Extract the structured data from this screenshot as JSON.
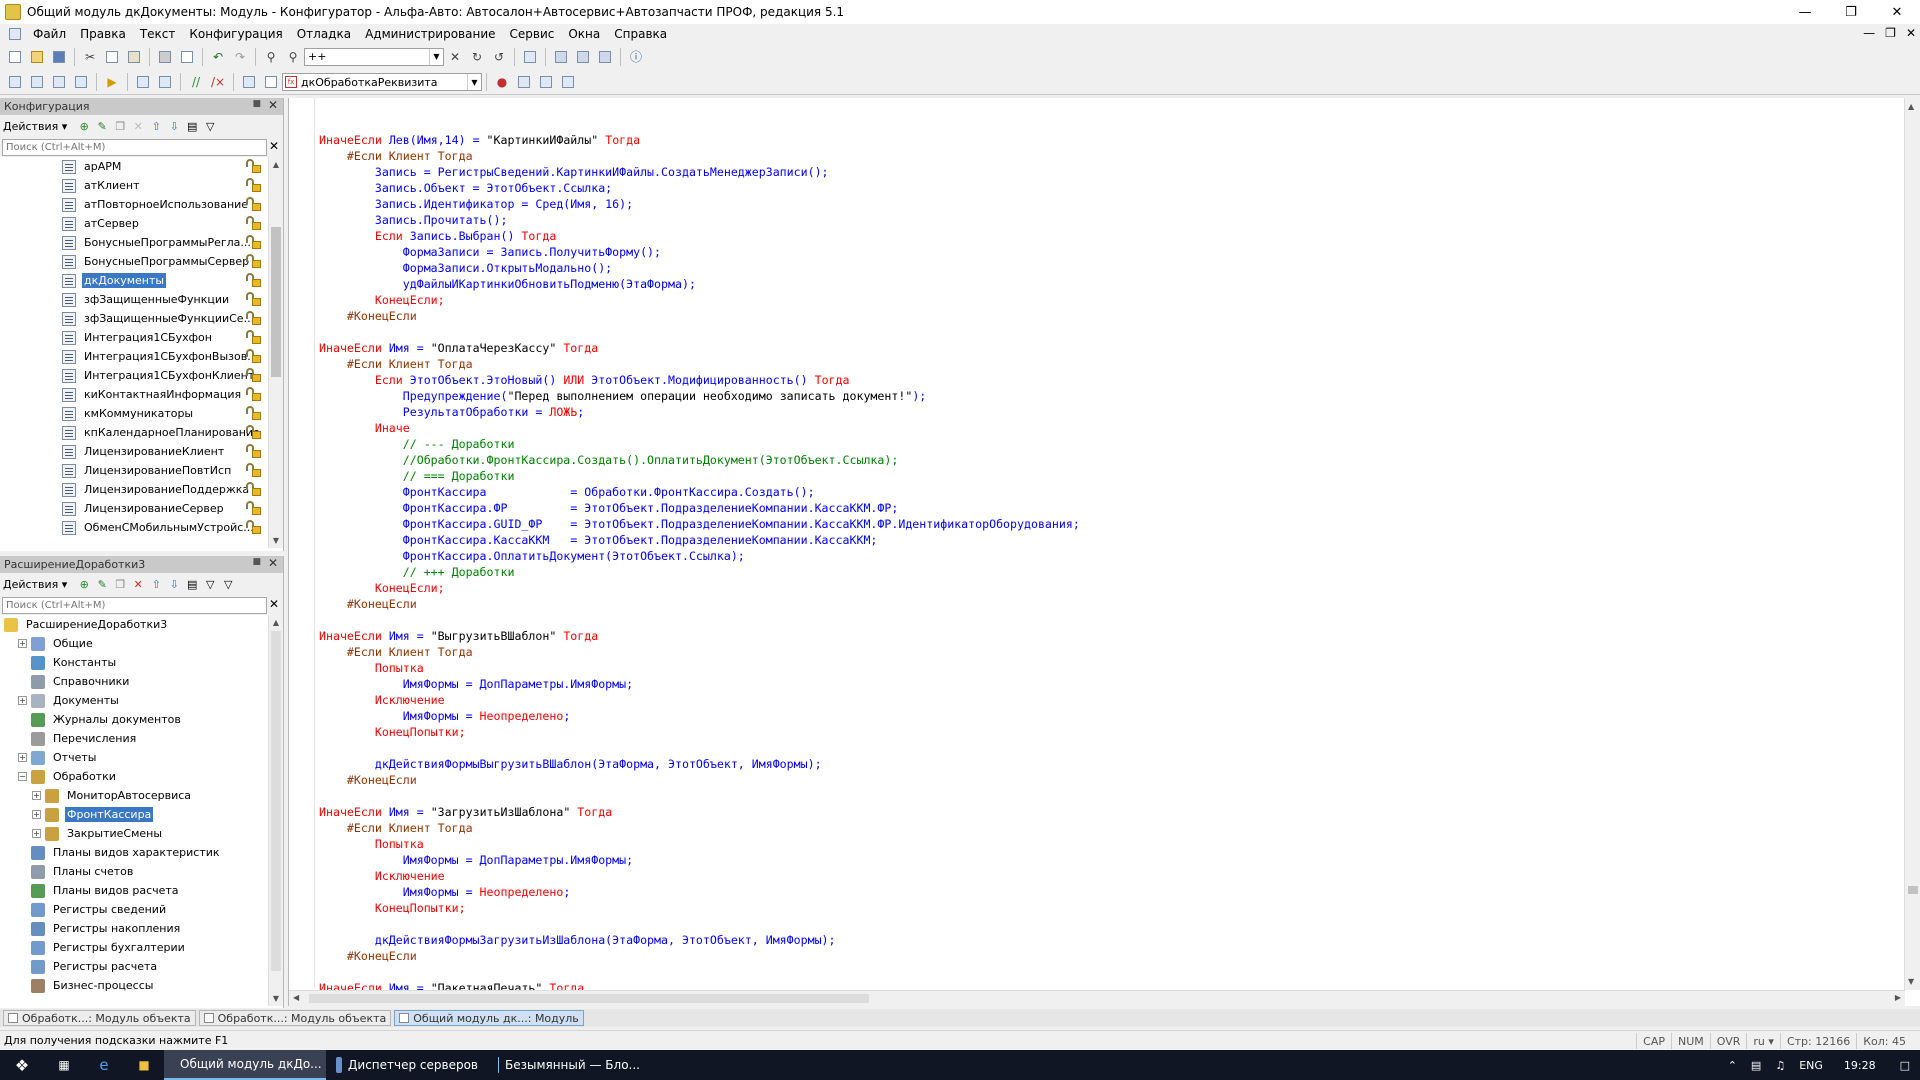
{
  "window": {
    "title": "Общий модуль дкДокументы: Модуль - Конфигуратор - Альфа-Авто: Автосалон+Автосервис+Автозапчасти ПРОФ, редакция 5.1"
  },
  "menu": [
    "Файл",
    "Правка",
    "Текст",
    "Конфигурация",
    "Отладка",
    "Администрирование",
    "Сервис",
    "Окна",
    "Справка"
  ],
  "toolbar": {
    "search_value": "++",
    "procedure_combo": "дкОбработкаРеквизита"
  },
  "config_panel": {
    "title": "Конфигурация",
    "actions_label": "Действия",
    "search_placeholder": "Поиск (Ctrl+Alt+M)",
    "items": [
      {
        "label": "арАРМ",
        "selected": false
      },
      {
        "label": "атКлиент",
        "selected": false
      },
      {
        "label": "атПовторноеИспользование",
        "selected": false
      },
      {
        "label": "атСервер",
        "selected": false
      },
      {
        "label": "БонусныеПрограммыРегла...",
        "selected": false
      },
      {
        "label": "БонусныеПрограммыСервер",
        "selected": false
      },
      {
        "label": "дкДокументы",
        "selected": true
      },
      {
        "label": "зфЗащищенныеФункции",
        "selected": false
      },
      {
        "label": "зфЗащищенныеФункцииСе...",
        "selected": false
      },
      {
        "label": "Интеграция1СБухфон",
        "selected": false
      },
      {
        "label": "Интеграция1СБухфонВызов...",
        "selected": false
      },
      {
        "label": "Интеграция1СБухфонКлиент",
        "selected": false
      },
      {
        "label": "киКонтактнаяИнформация",
        "selected": false
      },
      {
        "label": "кмКоммуникаторы",
        "selected": false
      },
      {
        "label": "кпКалендарноеПланирование",
        "selected": false
      },
      {
        "label": "ЛицензированиеКлиент",
        "selected": false
      },
      {
        "label": "ЛицензированиеПовтИсп",
        "selected": false
      },
      {
        "label": "ЛицензированиеПоддержка",
        "selected": false
      },
      {
        "label": "ЛицензированиеСервер",
        "selected": false
      },
      {
        "label": "ОбменСМобильнымУстройс...",
        "selected": false
      }
    ]
  },
  "ext_panel": {
    "title": "РасширениеДоработки3",
    "actions_label": "Действия",
    "search_placeholder": "Поиск (Ctrl+Alt+M)",
    "items": [
      {
        "label": "РасширениеДоработки3",
        "level": 0,
        "exp": "",
        "icon": "extension-icon",
        "selected": false
      },
      {
        "label": "Общие",
        "level": 1,
        "exp": "+",
        "icon": "common-icon",
        "selected": false
      },
      {
        "label": "Константы",
        "level": 1,
        "exp": "",
        "icon": "constants-icon",
        "selected": false
      },
      {
        "label": "Справочники",
        "level": 1,
        "exp": "",
        "icon": "catalogs-icon",
        "selected": false
      },
      {
        "label": "Документы",
        "level": 1,
        "exp": "+",
        "icon": "documents-icon",
        "selected": false
      },
      {
        "label": "Журналы документов",
        "level": 1,
        "exp": "",
        "icon": "journals-icon",
        "selected": false
      },
      {
        "label": "Перечисления",
        "level": 1,
        "exp": "",
        "icon": "enums-icon",
        "selected": false
      },
      {
        "label": "Отчеты",
        "level": 1,
        "exp": "+",
        "icon": "reports-icon",
        "selected": false
      },
      {
        "label": "Обработки",
        "level": 1,
        "exp": "−",
        "icon": "processing-icon",
        "selected": false
      },
      {
        "label": "МониторАвтосервиса",
        "level": 2,
        "exp": "+",
        "icon": "processing-item-icon",
        "selected": false
      },
      {
        "label": "ФронтКассира",
        "level": 2,
        "exp": "+",
        "icon": "processing-item-icon",
        "selected": true
      },
      {
        "label": "ЗакрытиеСмены",
        "level": 2,
        "exp": "+",
        "icon": "processing-item-icon",
        "selected": false
      },
      {
        "label": "Планы видов характеристик",
        "level": 1,
        "exp": "",
        "icon": "chart-of-characteristics-icon",
        "selected": false
      },
      {
        "label": "Планы счетов",
        "level": 1,
        "exp": "",
        "icon": "chart-of-accounts-icon",
        "selected": false
      },
      {
        "label": "Планы видов расчета",
        "level": 1,
        "exp": "",
        "icon": "chart-of-calculation-icon",
        "selected": false
      },
      {
        "label": "Регистры сведений",
        "level": 1,
        "exp": "",
        "icon": "info-registers-icon",
        "selected": false
      },
      {
        "label": "Регистры накопления",
        "level": 1,
        "exp": "",
        "icon": "accumulation-registers-icon",
        "selected": false
      },
      {
        "label": "Регистры бухгалтерии",
        "level": 1,
        "exp": "",
        "icon": "accounting-registers-icon",
        "selected": false
      },
      {
        "label": "Регистры расчета",
        "level": 1,
        "exp": "",
        "icon": "calculation-registers-icon",
        "selected": false
      },
      {
        "label": "Бизнес-процессы",
        "level": 1,
        "exp": "",
        "icon": "business-processes-icon",
        "selected": false
      }
    ]
  },
  "code_lines": [
    [],
    [
      [
        "kw",
        "ИначеЕсли "
      ],
      [
        "pl",
        "Лев(Имя,14) = "
      ],
      [
        "st",
        "\"КартинкиИФайлы\""
      ],
      [
        "kw",
        " Тогда"
      ]
    ],
    [
      [
        "pp",
        "    #Если Клиент Тогда"
      ]
    ],
    [
      [
        "pl",
        "        Запись = РегистрыСведений.КартинкиИФайлы.СоздатьМенеджерЗаписи();"
      ]
    ],
    [
      [
        "pl",
        "        Запись.Объект = ЭтотОбъект.Ссылка;"
      ]
    ],
    [
      [
        "pl",
        "        Запись.Идентификатор = Сред(Имя, 16);"
      ]
    ],
    [
      [
        "pl",
        "        Запись.Прочитать();"
      ]
    ],
    [
      [
        "kw",
        "        Если "
      ],
      [
        "pl",
        "Запись.Выбран()"
      ],
      [
        "kw",
        " Тогда"
      ]
    ],
    [
      [
        "pl",
        "            ФормаЗаписи = Запись.ПолучитьФорму();"
      ]
    ],
    [
      [
        "pl",
        "            ФормаЗаписи.ОткрытьМодально();"
      ]
    ],
    [
      [
        "pl",
        "            удФайлыИКартинкиОбновитьПодменю(ЭтаФорма);"
      ]
    ],
    [
      [
        "kw",
        "        КонецЕсли;"
      ]
    ],
    [
      [
        "pp",
        "    #КонецЕсли"
      ]
    ],
    [],
    [
      [
        "kw",
        "ИначеЕсли "
      ],
      [
        "pl",
        "Имя = "
      ],
      [
        "st",
        "\"ОплатаЧерезКассу\""
      ],
      [
        "kw",
        " Тогда"
      ]
    ],
    [
      [
        "pp",
        "    #Если Клиент Тогда"
      ]
    ],
    [
      [
        "kw",
        "        Если "
      ],
      [
        "pl",
        "ЭтотОбъект.ЭтоНовый() "
      ],
      [
        "kw",
        "ИЛИ "
      ],
      [
        "pl",
        "ЭтотОбъект.Модифицированность()"
      ],
      [
        "kw",
        " Тогда"
      ]
    ],
    [
      [
        "pl",
        "            Предупреждение("
      ],
      [
        "st",
        "\"Перед выполнением операции необходимо записать документ!\""
      ],
      [
        "pl",
        ");"
      ]
    ],
    [
      [
        "pl",
        "            РезультатОбработки = "
      ],
      [
        "kw",
        "ЛОЖЬ"
      ],
      [
        "pl",
        ";"
      ]
    ],
    [
      [
        "kw",
        "        Иначе"
      ]
    ],
    [
      [
        "cm",
        "            // --- Доработки"
      ]
    ],
    [
      [
        "cm",
        "            //Обработки.ФронтКассира.Создать().ОплатитьДокумент(ЭтотОбъект.Ссылка);"
      ]
    ],
    [
      [
        "cm",
        "            // === Доработки"
      ]
    ],
    [
      [
        "pl",
        "            ФронтКассира            = Обработки.ФронтКассира.Создать();"
      ]
    ],
    [
      [
        "pl",
        "            ФронтКассира.ФР         = ЭтотОбъект.ПодразделениеКомпании.КассаККМ.ФР;"
      ]
    ],
    [
      [
        "pl",
        "            ФронтКассира.GUID_ФР    = ЭтотОбъект.ПодразделениеКомпании.КассаККМ.ФР.ИдентификаторОборудования;"
      ]
    ],
    [
      [
        "pl",
        "            ФронтКассира.КассаККМ   = ЭтотОбъект.ПодразделениеКомпании.КассаККМ;"
      ]
    ],
    [
      [
        "pl",
        "            ФронтКассира.ОплатитьДокумент(ЭтотОбъект.Ссылка);"
      ]
    ],
    [
      [
        "cm",
        "            // +++ Доработки"
      ]
    ],
    [
      [
        "kw",
        "        КонецЕсли;"
      ]
    ],
    [
      [
        "pp",
        "    #КонецЕсли"
      ]
    ],
    [],
    [
      [
        "kw",
        "ИначеЕсли "
      ],
      [
        "pl",
        "Имя = "
      ],
      [
        "st",
        "\"ВыгрузитьВШаблон\""
      ],
      [
        "kw",
        " Тогда"
      ]
    ],
    [
      [
        "pp",
        "    #Если Клиент Тогда"
      ]
    ],
    [
      [
        "kw",
        "        Попытка"
      ]
    ],
    [
      [
        "pl",
        "            ИмяФормы = ДопПараметры.ИмяФормы;"
      ]
    ],
    [
      [
        "kw",
        "        Исключение"
      ]
    ],
    [
      [
        "pl",
        "            ИмяФормы = "
      ],
      [
        "kw",
        "Неопределено"
      ],
      [
        "pl",
        ";"
      ]
    ],
    [
      [
        "kw",
        "        КонецПопытки;"
      ]
    ],
    [],
    [
      [
        "pl",
        "        дкДействияФормыВыгрузитьВШаблон(ЭтаФорма, ЭтотОбъект, ИмяФормы);"
      ]
    ],
    [
      [
        "pp",
        "    #КонецЕсли"
      ]
    ],
    [],
    [
      [
        "kw",
        "ИначеЕсли "
      ],
      [
        "pl",
        "Имя = "
      ],
      [
        "st",
        "\"ЗагрузитьИзШаблона\""
      ],
      [
        "kw",
        " Тогда"
      ]
    ],
    [
      [
        "pp",
        "    #Если Клиент Тогда"
      ]
    ],
    [
      [
        "kw",
        "        Попытка"
      ]
    ],
    [
      [
        "pl",
        "            ИмяФормы = ДопПараметры.ИмяФормы;"
      ]
    ],
    [
      [
        "kw",
        "        Исключение"
      ]
    ],
    [
      [
        "pl",
        "            ИмяФормы = "
      ],
      [
        "kw",
        "Неопределено"
      ],
      [
        "pl",
        ";"
      ]
    ],
    [
      [
        "kw",
        "        КонецПопытки;"
      ]
    ],
    [],
    [
      [
        "pl",
        "        дкДействияФормыЗагрузитьИзШаблона(ЭтаФорма, ЭтотОбъект, ИмяФормы);"
      ]
    ],
    [
      [
        "pp",
        "    #КонецЕсли"
      ]
    ],
    [],
    [
      [
        "kw",
        "ИначеЕсли "
      ],
      [
        "pl",
        "Имя = "
      ],
      [
        "st",
        "\"ПакетнаяПечать\""
      ],
      [
        "kw",
        " Тогда"
      ]
    ]
  ],
  "doc_tabs": [
    {
      "label": "Обработк...: Модуль объекта",
      "active": false
    },
    {
      "label": "Обработк...: Модуль объекта",
      "active": false
    },
    {
      "label": "Общий модуль дк...: Модуль",
      "active": true
    }
  ],
  "status": {
    "hint": "Для получения подсказки нажмите F1",
    "cap": "CAP",
    "num": "NUM",
    "ovr": "OVR",
    "lang": "ru",
    "line": "Стр: 12166",
    "col": "Кол: 45"
  },
  "taskbar": {
    "apps": [
      {
        "label": "Общий модуль дкДо...",
        "active": true,
        "color": "#e3c44a"
      },
      {
        "label": "Диспетчер серверов",
        "active": false,
        "color": "#6a8fc9"
      },
      {
        "label": "Безымянный — Бло...",
        "active": false,
        "color": "#8fb8e0"
      }
    ],
    "lang": "ENG",
    "time": "19:28"
  }
}
